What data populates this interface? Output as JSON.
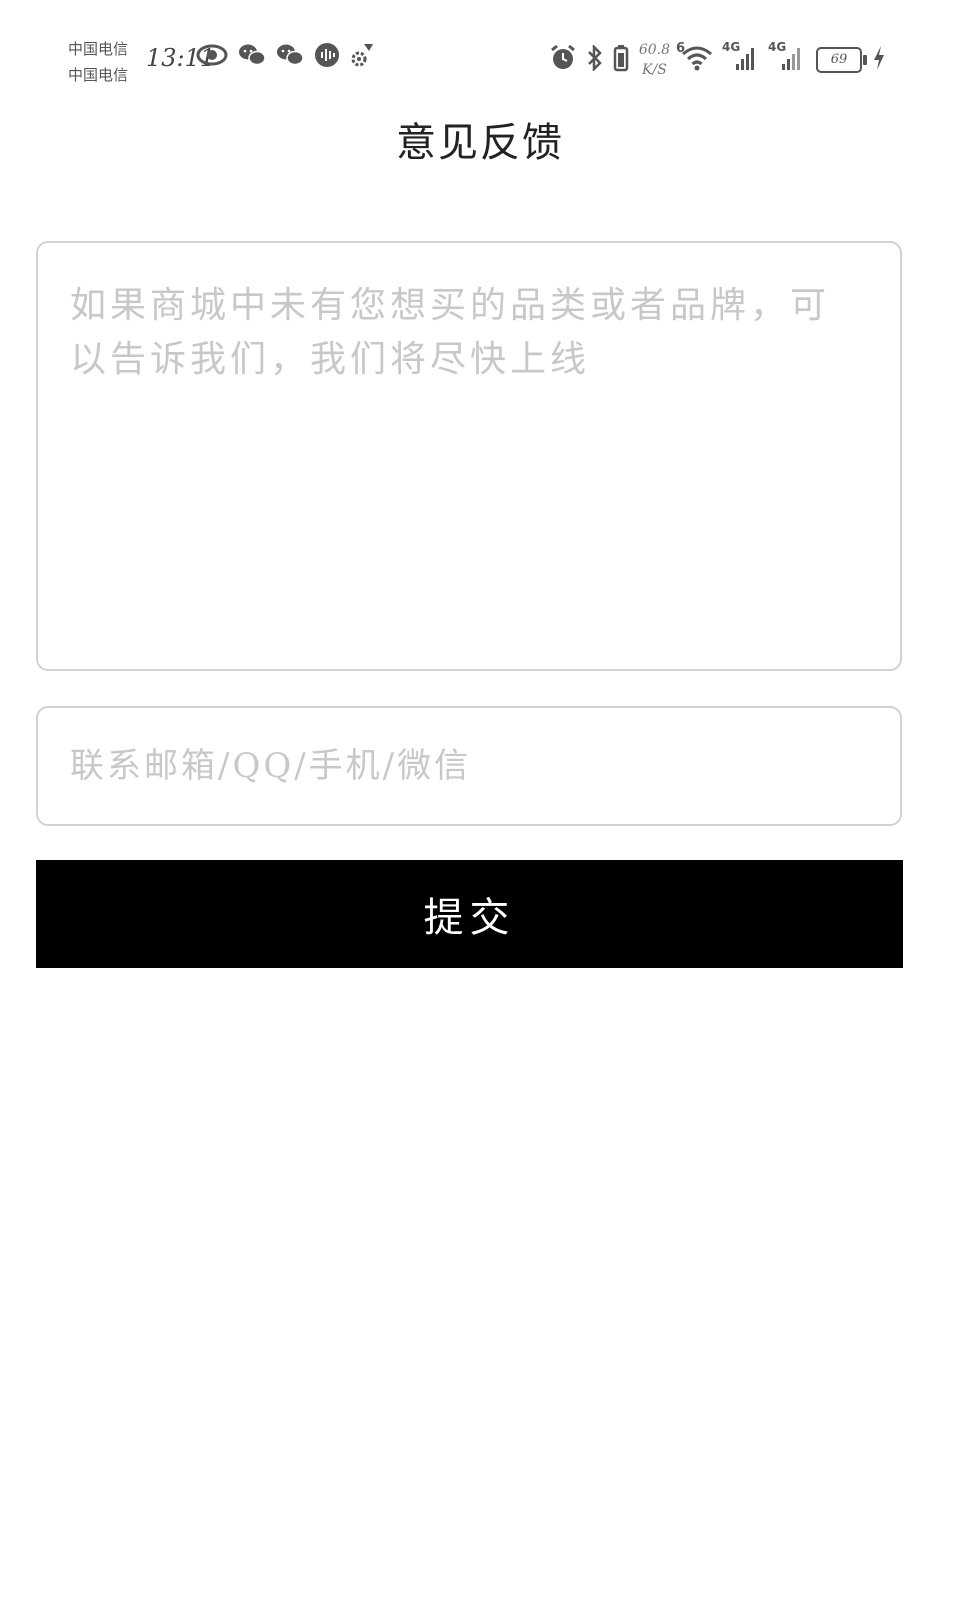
{
  "status_bar": {
    "carrier_1": "中国电信",
    "carrier_2": "中国电信",
    "time": "13:11",
    "net_speed_value": "60.8",
    "net_speed_unit": "K/S",
    "wifi_label": "6",
    "signal_1_label": "4G",
    "signal_2_label": "4G",
    "battery_level": "69",
    "left_icons": [
      "eye-icon",
      "wechat-icon",
      "wechat-icon",
      "voice-wave-icon",
      "gear-icon"
    ],
    "right_icons": [
      "alarm-icon",
      "bluetooth-icon",
      "wifi-icon",
      "signal-icon",
      "signal-icon",
      "battery-icon",
      "charging-icon"
    ]
  },
  "header": {
    "title": "意见反馈"
  },
  "form": {
    "feedback_placeholder": "如果商城中未有您想买的品类或者品牌，可以告诉我们，我们将尽快上线",
    "feedback_value": "",
    "contact_placeholder": "联系邮箱/QQ/手机/微信",
    "contact_value": "",
    "submit_label": "提交"
  },
  "colors": {
    "button_bg": "#000000",
    "button_text": "#ffffff",
    "border": "#d2d2d2",
    "placeholder": "#c8c8c8"
  }
}
